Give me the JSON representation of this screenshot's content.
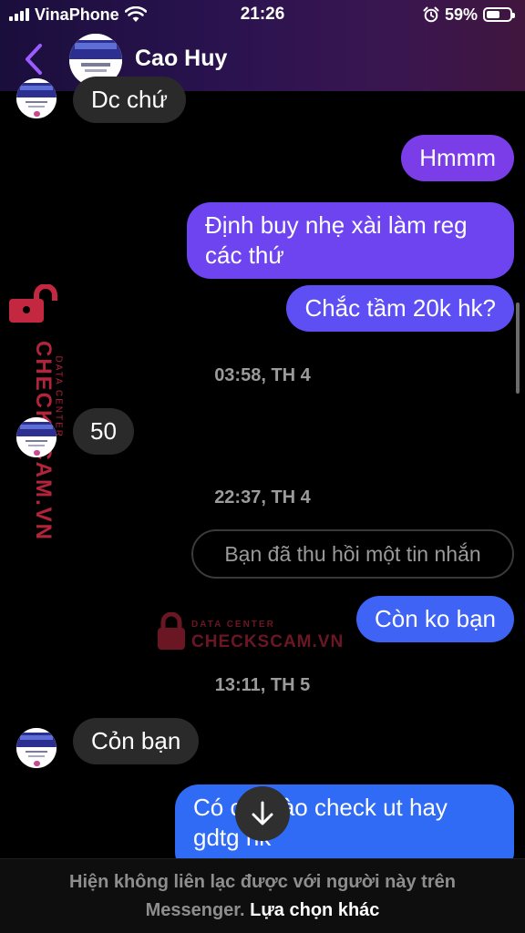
{
  "status_bar": {
    "carrier": "VinaPhone",
    "time": "21:26",
    "battery_percent": "59%",
    "battery_level": 0.59,
    "icons": [
      "signal-icon",
      "wifi-icon",
      "alarm-icon",
      "battery-icon"
    ]
  },
  "header": {
    "contact_name": "Cao Huy",
    "back_icon": "chevron-left-icon",
    "accent_color": "#9b5cff"
  },
  "messages": [
    {
      "side": "in",
      "text": "Dc chứ"
    },
    {
      "side": "out",
      "text": "Hmmm"
    },
    {
      "side": "out",
      "text": "Định buy nhẹ xài làm reg các thứ"
    },
    {
      "side": "out",
      "text": "Chắc tầm 20k hk?"
    },
    {
      "type": "time",
      "text": "03:58, TH 4"
    },
    {
      "side": "in",
      "text": "50"
    },
    {
      "type": "time",
      "text": "22:37, TH 4"
    },
    {
      "type": "unsent",
      "text": "Bạn đã thu hồi một tin nhắn"
    },
    {
      "side": "out",
      "text": "Còn ko bạn"
    },
    {
      "type": "time",
      "text": "13:11, TH 5"
    },
    {
      "side": "in",
      "text": "Cỏn bạn"
    },
    {
      "side": "out",
      "text": "Có c... nào check ut hay gdtg hk"
    }
  ],
  "watermark": {
    "brand": "CHECKSCAM.VN",
    "tag": "DATA CENTER",
    "color": "#c42840"
  },
  "footer": {
    "notice": "Hiện không liên lạc được với người này trên",
    "notice_2": "Messenger.",
    "link": "Lựa chọn khác"
  },
  "scroll_down_icon": "arrow-down-icon"
}
